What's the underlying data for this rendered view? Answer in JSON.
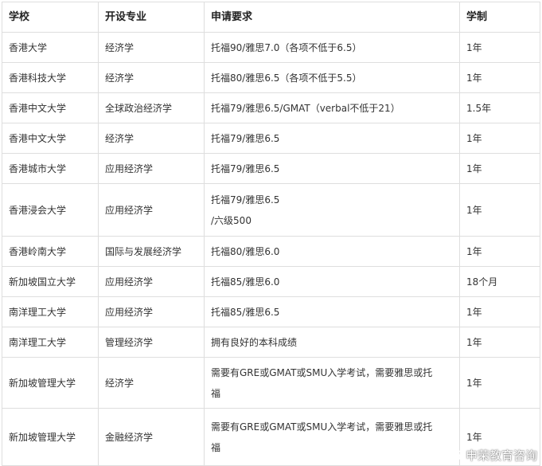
{
  "table": {
    "headers": [
      "学校",
      "开设专业",
      "申请要求",
      "学制"
    ],
    "rows": [
      {
        "school": "香港大学",
        "major": "经济学",
        "requirements": [
          "托福90/雅思7.0（各项不低于6.5）"
        ],
        "duration": "1年"
      },
      {
        "school": "香港科技大学",
        "major": "经济学",
        "requirements": [
          "托福80/雅思6.5（各项不低于5.5）"
        ],
        "duration": "1年"
      },
      {
        "school": "香港中文大学",
        "major": "全球政治经济学",
        "requirements": [
          "托福79/雅思6.5/GMAT（verbal不低于21）"
        ],
        "duration": "1.5年"
      },
      {
        "school": "香港中文大学",
        "major": "经济学",
        "requirements": [
          "托福79/雅思6.5"
        ],
        "duration": "1年"
      },
      {
        "school": "香港城市大学",
        "major": "应用经济学",
        "requirements": [
          "托福79/雅思6.5"
        ],
        "duration": "1年"
      },
      {
        "school": "香港浸会大学",
        "major": "应用经济学",
        "requirements": [
          "托福79/雅思6.5",
          "/六级500"
        ],
        "duration": "1年"
      },
      {
        "school": "香港岭南大学",
        "major": "国际与发展经济学",
        "requirements": [
          "托福80/雅思6.0"
        ],
        "duration": "1年"
      },
      {
        "school": "新加坡国立大学",
        "major": "应用经济学",
        "requirements": [
          "托福85/雅思6.0"
        ],
        "duration": "18个月"
      },
      {
        "school": "南洋理工大学",
        "major": "应用经济学",
        "requirements": [
          "托福85/雅思6.5"
        ],
        "duration": "1年"
      },
      {
        "school": "南洋理工大学",
        "major": "管理经济学",
        "requirements": [
          "拥有良好的本科成绩"
        ],
        "duration": "1年"
      },
      {
        "school": "新加坡管理大学",
        "major": "经济学",
        "requirements": [
          "需要有GRE或GMAT或SMU入学考试，需要雅思或托",
          "福"
        ],
        "duration": "1年"
      },
      {
        "school": "新加坡管理大学",
        "major": "金融经济学",
        "requirements": [
          "需要有GRE或GMAT或SMU入学考试，需要雅思或托",
          "福"
        ],
        "duration": "1年"
      }
    ]
  },
  "watermark": {
    "text": "申荣教育咨询",
    "icon": "weibo-icon"
  },
  "colors": {
    "border": "#dedede",
    "text": "#333333"
  }
}
